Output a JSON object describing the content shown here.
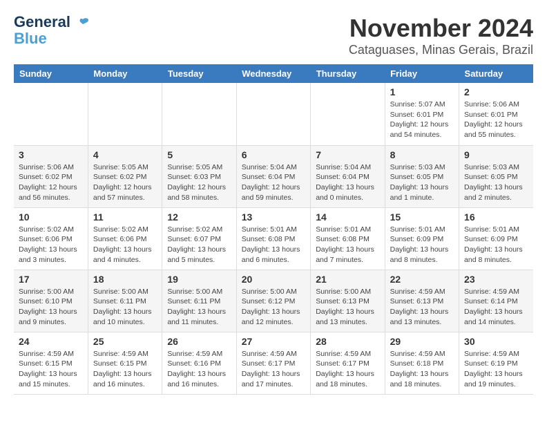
{
  "logo": {
    "line1": "General",
    "line2": "Blue"
  },
  "title": "November 2024",
  "location": "Cataguases, Minas Gerais, Brazil",
  "weekdays": [
    "Sunday",
    "Monday",
    "Tuesday",
    "Wednesday",
    "Thursday",
    "Friday",
    "Saturday"
  ],
  "weeks": [
    [
      {
        "day": "",
        "info": ""
      },
      {
        "day": "",
        "info": ""
      },
      {
        "day": "",
        "info": ""
      },
      {
        "day": "",
        "info": ""
      },
      {
        "day": "",
        "info": ""
      },
      {
        "day": "1",
        "info": "Sunrise: 5:07 AM\nSunset: 6:01 PM\nDaylight: 12 hours\nand 54 minutes."
      },
      {
        "day": "2",
        "info": "Sunrise: 5:06 AM\nSunset: 6:01 PM\nDaylight: 12 hours\nand 55 minutes."
      }
    ],
    [
      {
        "day": "3",
        "info": "Sunrise: 5:06 AM\nSunset: 6:02 PM\nDaylight: 12 hours\nand 56 minutes."
      },
      {
        "day": "4",
        "info": "Sunrise: 5:05 AM\nSunset: 6:02 PM\nDaylight: 12 hours\nand 57 minutes."
      },
      {
        "day": "5",
        "info": "Sunrise: 5:05 AM\nSunset: 6:03 PM\nDaylight: 12 hours\nand 58 minutes."
      },
      {
        "day": "6",
        "info": "Sunrise: 5:04 AM\nSunset: 6:04 PM\nDaylight: 12 hours\nand 59 minutes."
      },
      {
        "day": "7",
        "info": "Sunrise: 5:04 AM\nSunset: 6:04 PM\nDaylight: 13 hours\nand 0 minutes."
      },
      {
        "day": "8",
        "info": "Sunrise: 5:03 AM\nSunset: 6:05 PM\nDaylight: 13 hours\nand 1 minute."
      },
      {
        "day": "9",
        "info": "Sunrise: 5:03 AM\nSunset: 6:05 PM\nDaylight: 13 hours\nand 2 minutes."
      }
    ],
    [
      {
        "day": "10",
        "info": "Sunrise: 5:02 AM\nSunset: 6:06 PM\nDaylight: 13 hours\nand 3 minutes."
      },
      {
        "day": "11",
        "info": "Sunrise: 5:02 AM\nSunset: 6:06 PM\nDaylight: 13 hours\nand 4 minutes."
      },
      {
        "day": "12",
        "info": "Sunrise: 5:02 AM\nSunset: 6:07 PM\nDaylight: 13 hours\nand 5 minutes."
      },
      {
        "day": "13",
        "info": "Sunrise: 5:01 AM\nSunset: 6:08 PM\nDaylight: 13 hours\nand 6 minutes."
      },
      {
        "day": "14",
        "info": "Sunrise: 5:01 AM\nSunset: 6:08 PM\nDaylight: 13 hours\nand 7 minutes."
      },
      {
        "day": "15",
        "info": "Sunrise: 5:01 AM\nSunset: 6:09 PM\nDaylight: 13 hours\nand 8 minutes."
      },
      {
        "day": "16",
        "info": "Sunrise: 5:01 AM\nSunset: 6:09 PM\nDaylight: 13 hours\nand 8 minutes."
      }
    ],
    [
      {
        "day": "17",
        "info": "Sunrise: 5:00 AM\nSunset: 6:10 PM\nDaylight: 13 hours\nand 9 minutes."
      },
      {
        "day": "18",
        "info": "Sunrise: 5:00 AM\nSunset: 6:11 PM\nDaylight: 13 hours\nand 10 minutes."
      },
      {
        "day": "19",
        "info": "Sunrise: 5:00 AM\nSunset: 6:11 PM\nDaylight: 13 hours\nand 11 minutes."
      },
      {
        "day": "20",
        "info": "Sunrise: 5:00 AM\nSunset: 6:12 PM\nDaylight: 13 hours\nand 12 minutes."
      },
      {
        "day": "21",
        "info": "Sunrise: 5:00 AM\nSunset: 6:13 PM\nDaylight: 13 hours\nand 13 minutes."
      },
      {
        "day": "22",
        "info": "Sunrise: 4:59 AM\nSunset: 6:13 PM\nDaylight: 13 hours\nand 13 minutes."
      },
      {
        "day": "23",
        "info": "Sunrise: 4:59 AM\nSunset: 6:14 PM\nDaylight: 13 hours\nand 14 minutes."
      }
    ],
    [
      {
        "day": "24",
        "info": "Sunrise: 4:59 AM\nSunset: 6:15 PM\nDaylight: 13 hours\nand 15 minutes."
      },
      {
        "day": "25",
        "info": "Sunrise: 4:59 AM\nSunset: 6:15 PM\nDaylight: 13 hours\nand 16 minutes."
      },
      {
        "day": "26",
        "info": "Sunrise: 4:59 AM\nSunset: 6:16 PM\nDaylight: 13 hours\nand 16 minutes."
      },
      {
        "day": "27",
        "info": "Sunrise: 4:59 AM\nSunset: 6:17 PM\nDaylight: 13 hours\nand 17 minutes."
      },
      {
        "day": "28",
        "info": "Sunrise: 4:59 AM\nSunset: 6:17 PM\nDaylight: 13 hours\nand 18 minutes."
      },
      {
        "day": "29",
        "info": "Sunrise: 4:59 AM\nSunset: 6:18 PM\nDaylight: 13 hours\nand 18 minutes."
      },
      {
        "day": "30",
        "info": "Sunrise: 4:59 AM\nSunset: 6:19 PM\nDaylight: 13 hours\nand 19 minutes."
      }
    ]
  ]
}
